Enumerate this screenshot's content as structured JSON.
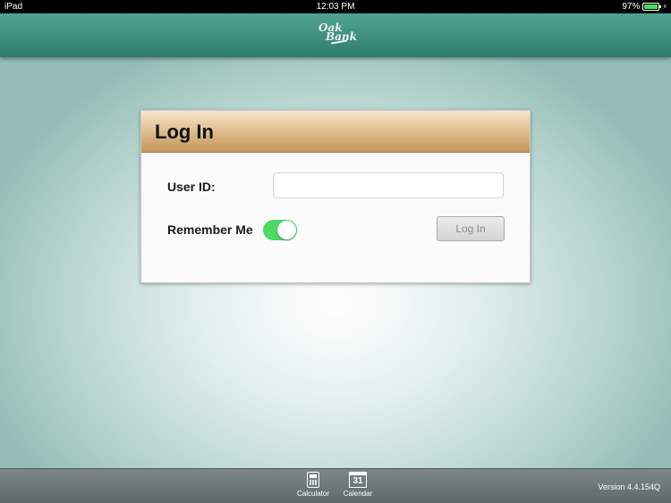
{
  "status_bar": {
    "device": "iPad",
    "time": "12:03 PM",
    "battery": "97%",
    "battery_level": 0.97,
    "battery_color": "#4cd964"
  },
  "header": {
    "logo_line1": "Oak",
    "logo_line2": "Bank",
    "color": "#3f8f7f"
  },
  "login": {
    "title": "Log In",
    "user_id_label": "User ID:",
    "user_id_value": "",
    "remember_label": "Remember Me",
    "remember_on": true,
    "button_label": "Log In",
    "header_color": "#d8b07c",
    "toggle_color": "#4cd964"
  },
  "footer": {
    "items": [
      {
        "label": "Calculator",
        "icon": "calculator-icon"
      },
      {
        "label": "Calendar",
        "icon": "calendar-icon",
        "icon_text": "31"
      }
    ],
    "version": "Version 4.4.154Q"
  }
}
